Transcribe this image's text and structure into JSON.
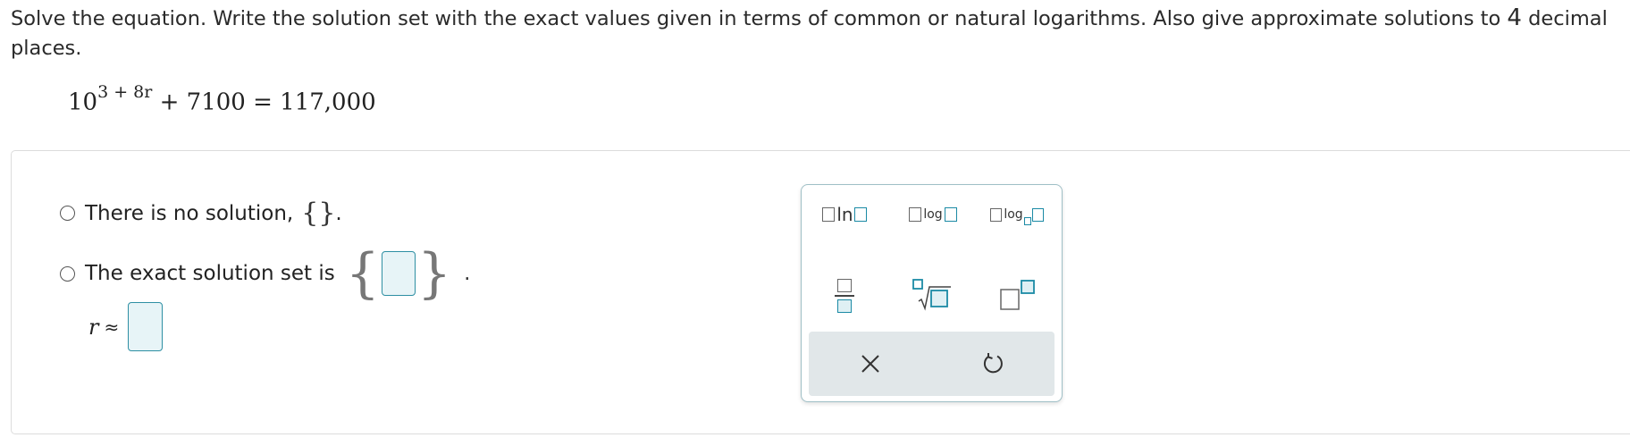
{
  "instructions": {
    "text_part1": "Solve the equation. Write the solution set with the exact values given in terms of common or natural logarithms. Also give approximate solutions to ",
    "decimal_places": "4",
    "text_part2": " decimal places."
  },
  "equation": {
    "base": "10",
    "exponent": "3 + 8r",
    "rest": " + 7100 = 117,000"
  },
  "options": {
    "no_solution_label": "There is no solution,",
    "empty_set": "{}",
    "no_solution_period": ".",
    "exact_label": "The exact solution set is",
    "exact_period": "."
  },
  "approx": {
    "variable": "r",
    "symbol": "≈"
  },
  "palette": {
    "ln_text": "ln",
    "log_text": "log",
    "logb_text": "log",
    "icons": [
      "ln-template-icon",
      "log-template-icon",
      "log-base-template-icon",
      "fraction-template-icon",
      "nth-root-template-icon",
      "exponent-template-icon",
      "clear-icon",
      "undo-icon"
    ]
  },
  "colors": {
    "accent": "#1b8aa5",
    "input_fill": "#e7f4f7",
    "action_bar": "#e1e7e9"
  }
}
